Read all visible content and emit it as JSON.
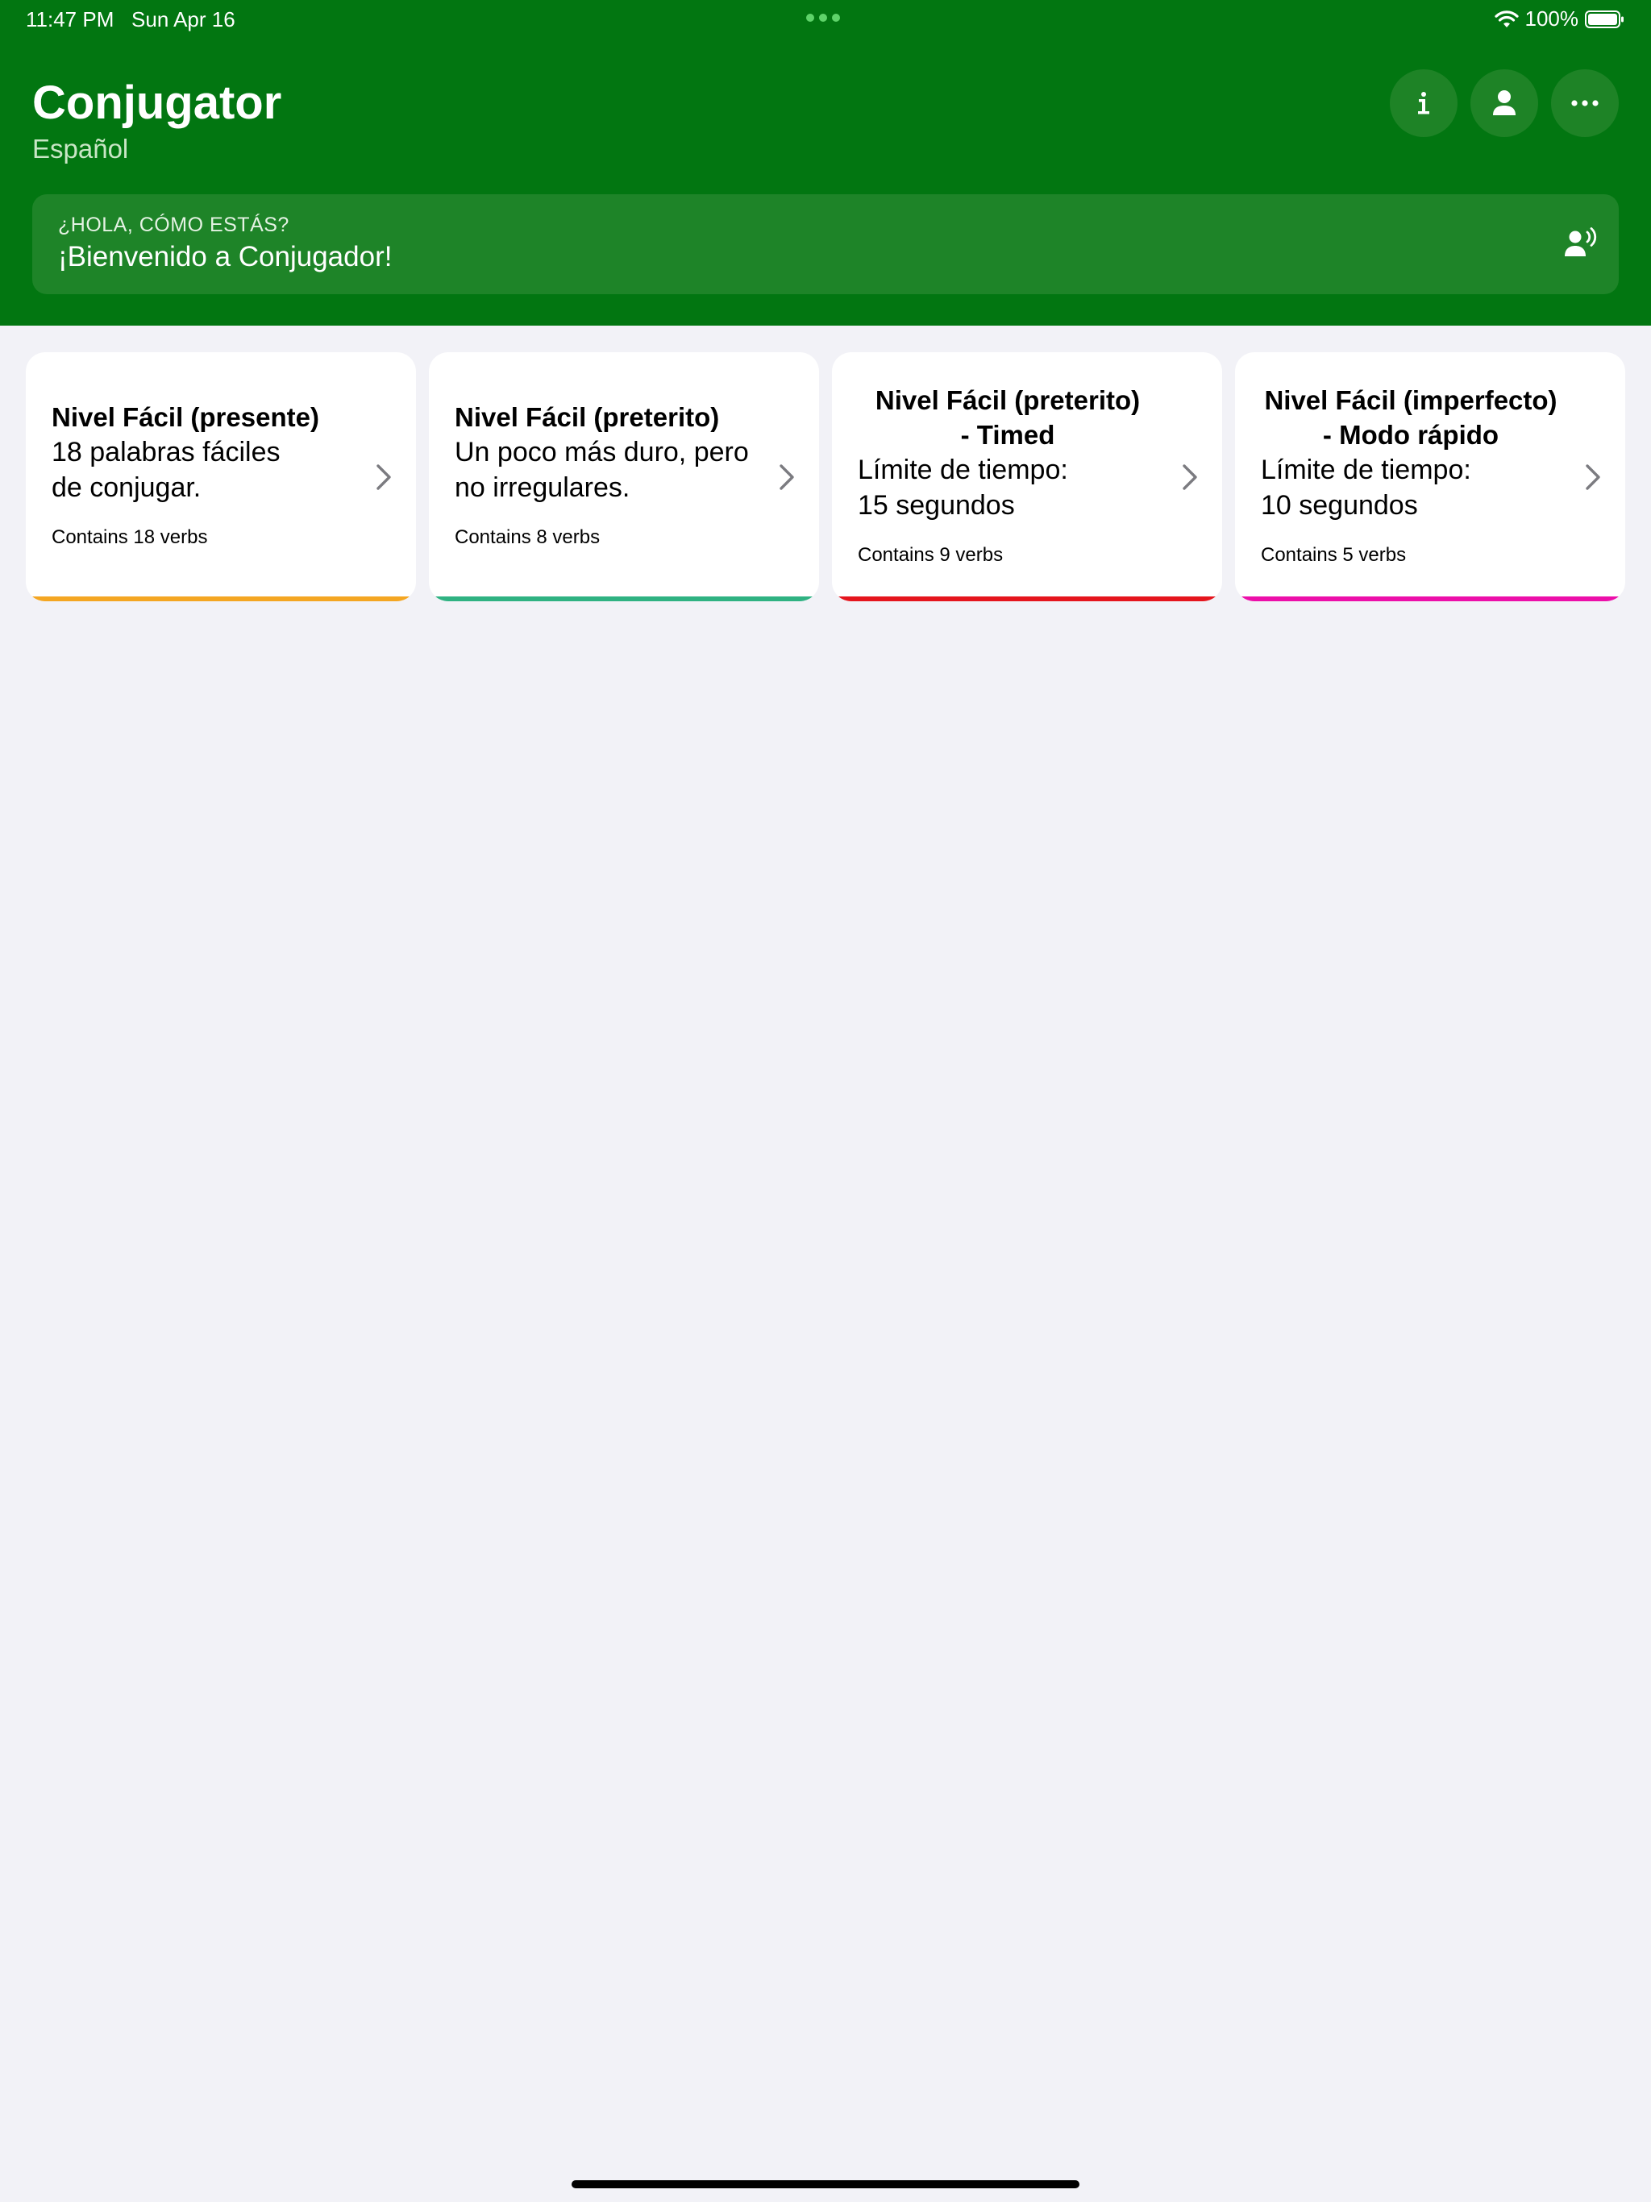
{
  "status_bar": {
    "time": "11:47 PM   Sun Apr 16",
    "battery": "100%"
  },
  "header": {
    "title": "Conjugator",
    "subtitle": "Español",
    "buttons": [
      {
        "icon": "info-icon"
      },
      {
        "icon": "person-icon"
      },
      {
        "icon": "ellipsis-icon"
      }
    ]
  },
  "greeting": {
    "caption": "¿HOLA, CÓMO ESTÁS?",
    "text": "¡Bienvenido a Conjugador!",
    "icon": "speak-icon"
  },
  "cards": [
    {
      "title": "Nivel Fácil (presente)",
      "description": "18 palabras fáciles\nde conjugar.",
      "count": "Contains 18 verbs",
      "accent": "#f4a622"
    },
    {
      "title": "Nivel Fácil (preterito)",
      "description": "Un poco más duro, pero\nno irregulares.",
      "count": "Contains 8 verbs",
      "accent": "#2fb282"
    },
    {
      "title": "Nivel Fácil (preterito)\n- Timed",
      "description": "Límite de tiempo:\n15 segundos",
      "count": "Contains 9 verbs",
      "accent": "#e5151d"
    },
    {
      "title": "Nivel Fácil (imperfecto)\n- Modo rápido",
      "description": "Límite de tiempo:\n10 segundos",
      "count": "Contains 5 verbs",
      "accent": "#ec0fa9"
    }
  ],
  "colors": {
    "header_bg": "#027611",
    "page_bg": "#f2f2f7"
  }
}
